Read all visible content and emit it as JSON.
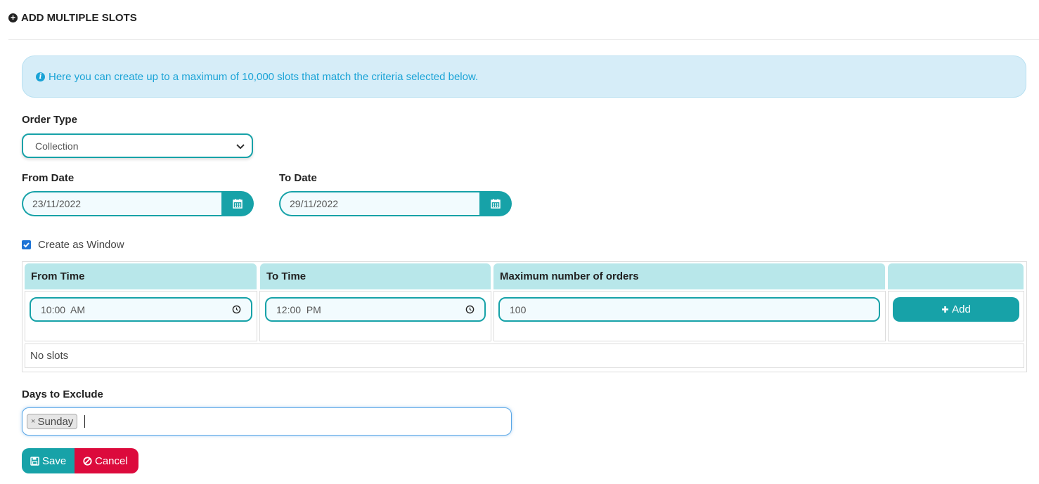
{
  "header": {
    "title": "ADD MULTIPLE SLOTS",
    "title_icon": "plus-circle-icon"
  },
  "info": {
    "text": "Here you can create up to a maximum of 10,000 slots that match the criteria selected below.",
    "icon": "info-circle-icon"
  },
  "order_type": {
    "label": "Order Type",
    "selected": "Collection"
  },
  "from_date": {
    "label": "From Date",
    "value": "23/11/2022"
  },
  "to_date": {
    "label": "To Date",
    "value": "29/11/2022"
  },
  "window": {
    "label": "Create as Window",
    "checked": true
  },
  "slots_table": {
    "headers": [
      "From Time",
      "To Time",
      "Maximum number of orders",
      ""
    ],
    "from_time": "10:00  AM",
    "to_time": "12:00  PM",
    "max_orders": "100",
    "add_label": "Add",
    "empty_text": "No slots"
  },
  "exclude": {
    "label": "Days to Exclude",
    "tags": [
      "Sunday"
    ]
  },
  "actions": {
    "save_label": "Save",
    "cancel_label": "Cancel"
  },
  "colors": {
    "accent": "#17a2a8",
    "danger": "#dc0a3c",
    "info_bg": "#d6edf8",
    "info_text": "#1aa3d6",
    "table_header": "#b8e7ea"
  }
}
